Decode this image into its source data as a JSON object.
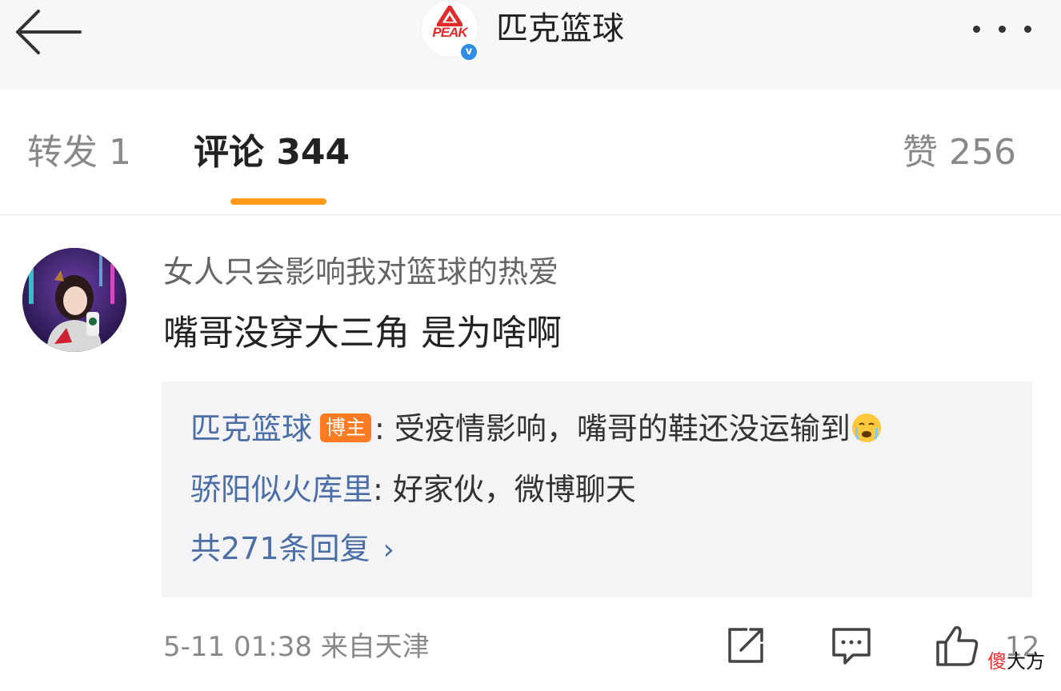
{
  "header": {
    "title": "匹克篮球",
    "logo_text": "PEAK",
    "verified_mark": "v",
    "back_icon": "arrow-left-icon",
    "more_icon": "more-dots-icon"
  },
  "tabs": {
    "repost": "转发 1",
    "comment": "评论 344",
    "like": "赞 256",
    "active": "comment",
    "accent_color": "#ff9a1a"
  },
  "comment": {
    "username": "女人只会影响我对篮球的热爱",
    "text": "嘴哥没穿大三角 是为啥啊",
    "replies": [
      {
        "name": "匹克篮球",
        "badge": "博主",
        "separator": ":",
        "text": " 受疫情影响，嘴哥的鞋还没运输到"
      },
      {
        "name": "骄阳似火库里",
        "separator": ":",
        "text": " 好家伙，微博聊天"
      }
    ],
    "more_replies": "共271条回复",
    "time_location": "5-11 01:38  来自天津",
    "like_count": "12"
  },
  "watermark": {
    "part1": "傻",
    "part2": "大方"
  },
  "colors": {
    "link": "#4a6ea5",
    "badge": "#ff7b22",
    "verified": "#2f8de4",
    "brand_red": "#e12a2a"
  }
}
